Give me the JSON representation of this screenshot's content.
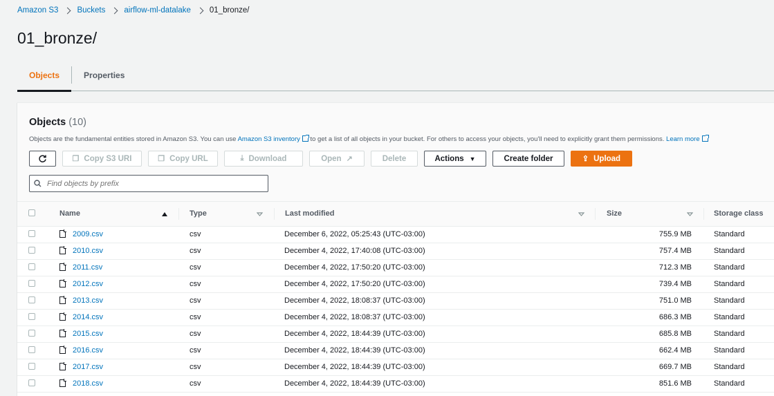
{
  "breadcrumb": {
    "items": [
      "Amazon S3",
      "Buckets",
      "airflow-ml-datalake"
    ],
    "current": "01_bronze/"
  },
  "page_title": "01_bronze/",
  "tabs": [
    "Objects",
    "Properties"
  ],
  "objects_panel": {
    "title": "Objects",
    "count": "(10)",
    "desc_part1": "Objects are the fundamental entities stored in Amazon S3. You can use ",
    "desc_link1": "Amazon S3 inventory",
    "desc_part2": " to get a list of all objects in your bucket. For others to access your objects, you'll need to explicitly grant them permissions. ",
    "desc_link2": "Learn more"
  },
  "toolbar": {
    "refresh_label": "",
    "copy_uri_label": "Copy S3 URI",
    "copy_url_label": "Copy URL",
    "download_label": "Download",
    "open_label": "Open",
    "delete_label": "Delete",
    "actions_label": "Actions",
    "create_folder_label": "Create folder",
    "upload_label": "Upload"
  },
  "search": {
    "placeholder": "Find objects by prefix"
  },
  "table": {
    "headers": [
      "Name",
      "Type",
      "Last modified",
      "Size",
      "Storage class"
    ],
    "rows": [
      {
        "name": "2009.csv",
        "type": "csv",
        "modified": "December 6, 2022, 05:25:43 (UTC-03:00)",
        "size": "755.9 MB",
        "storage": "Standard"
      },
      {
        "name": "2010.csv",
        "type": "csv",
        "modified": "December 4, 2022, 17:40:08 (UTC-03:00)",
        "size": "757.4 MB",
        "storage": "Standard"
      },
      {
        "name": "2011.csv",
        "type": "csv",
        "modified": "December 4, 2022, 17:50:20 (UTC-03:00)",
        "size": "712.3 MB",
        "storage": "Standard"
      },
      {
        "name": "2012.csv",
        "type": "csv",
        "modified": "December 4, 2022, 17:50:20 (UTC-03:00)",
        "size": "739.4 MB",
        "storage": "Standard"
      },
      {
        "name": "2013.csv",
        "type": "csv",
        "modified": "December 4, 2022, 18:08:37 (UTC-03:00)",
        "size": "751.0 MB",
        "storage": "Standard"
      },
      {
        "name": "2014.csv",
        "type": "csv",
        "modified": "December 4, 2022, 18:08:37 (UTC-03:00)",
        "size": "686.3 MB",
        "storage": "Standard"
      },
      {
        "name": "2015.csv",
        "type": "csv",
        "modified": "December 4, 2022, 18:44:39 (UTC-03:00)",
        "size": "685.8 MB",
        "storage": "Standard"
      },
      {
        "name": "2016.csv",
        "type": "csv",
        "modified": "December 4, 2022, 18:44:39 (UTC-03:00)",
        "size": "662.4 MB",
        "storage": "Standard"
      },
      {
        "name": "2017.csv",
        "type": "csv",
        "modified": "December 4, 2022, 18:44:39 (UTC-03:00)",
        "size": "669.7 MB",
        "storage": "Standard"
      },
      {
        "name": "2018.csv",
        "type": "csv",
        "modified": "December 4, 2022, 18:44:39 (UTC-03:00)",
        "size": "851.6 MB",
        "storage": "Standard"
      }
    ]
  },
  "colors": {
    "accent": "#ec7211",
    "link": "#0073bb",
    "text": "#16191f"
  }
}
